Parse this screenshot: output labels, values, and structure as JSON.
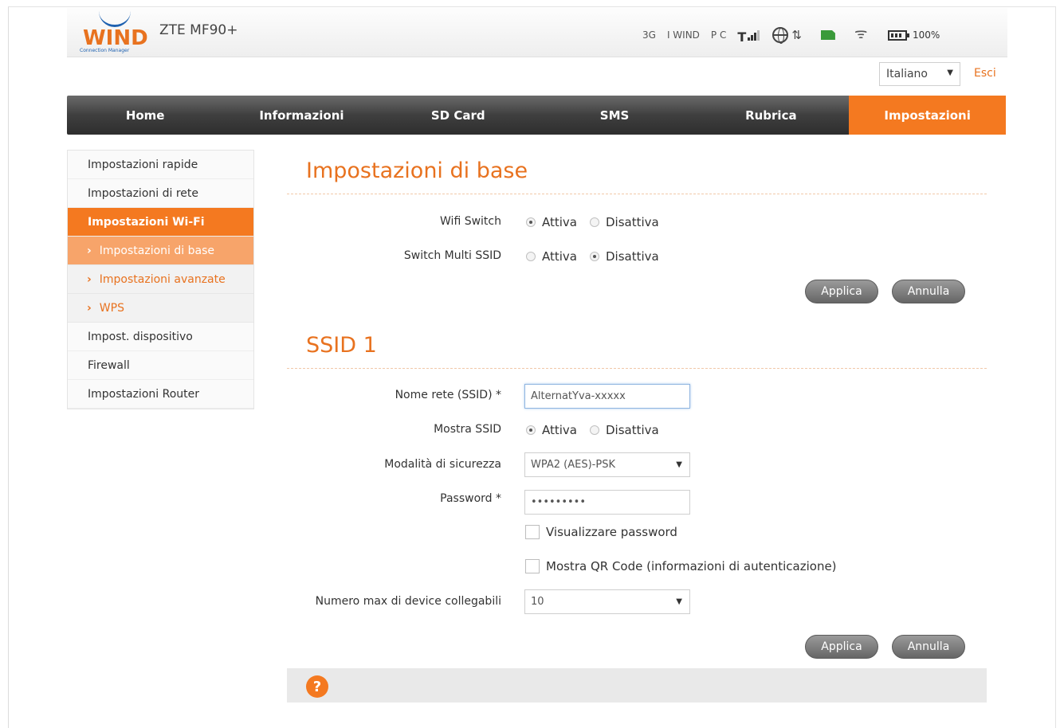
{
  "header": {
    "logo_text": "WIND",
    "logo_subtitle": "Connection Manager",
    "model": "ZTE MF90+",
    "network_type": "3G",
    "operator": "I WIND",
    "roaming_label": "P C",
    "battery_pct": "100%"
  },
  "language": {
    "selected": "Italiano",
    "logout": "Esci"
  },
  "nav": {
    "items": [
      "Home",
      "Informazioni",
      "SD Card",
      "SMS",
      "Rubrica",
      "Impostazioni"
    ],
    "active": "Impostazioni"
  },
  "sidebar": {
    "items": [
      {
        "label": "Impostazioni rapide"
      },
      {
        "label": "Impostazioni di rete"
      },
      {
        "label": "Impostazioni Wi-Fi",
        "active": true
      },
      {
        "label": "Impostazioni di base",
        "sub": true,
        "active": true
      },
      {
        "label": "Impostazioni avanzate",
        "sub": true
      },
      {
        "label": "WPS",
        "sub": true
      },
      {
        "label": "Impost. dispositivo"
      },
      {
        "label": "Firewall"
      },
      {
        "label": "Impostazioni Router"
      }
    ]
  },
  "basic": {
    "title": "Impostazioni di base",
    "wifi_switch_label": "Wifi Switch",
    "multi_ssid_label": "Switch Multi SSID",
    "option_on": "Attiva",
    "option_off": "Disattiva",
    "wifi_switch_value": "Attiva",
    "multi_ssid_value": "Disattiva",
    "apply": "Applica",
    "cancel": "Annulla"
  },
  "ssid1": {
    "title": "SSID 1",
    "ssid_label": "Nome rete (SSID) *",
    "ssid_value": "AlternatYva-xxxxx",
    "broadcast_label": "Mostra SSID",
    "broadcast_value": "Attiva",
    "option_on": "Attiva",
    "option_off": "Disattiva",
    "security_label": "Modalità di sicurezza",
    "security_value": "WPA2 (AES)-PSK",
    "password_label": "Password *",
    "password_value": "•••••••••",
    "show_password": "Visualizzare password",
    "show_qr": "Mostra QR Code (informazioni di autenticazione)",
    "max_devices_label": "Numero max di device collegabili",
    "max_devices_value": "10",
    "apply": "Applica",
    "cancel": "Annulla"
  },
  "colors": {
    "accent": "#f47920",
    "nav_dark": "#3f3f3f",
    "brand_blue": "#1e61b0"
  }
}
